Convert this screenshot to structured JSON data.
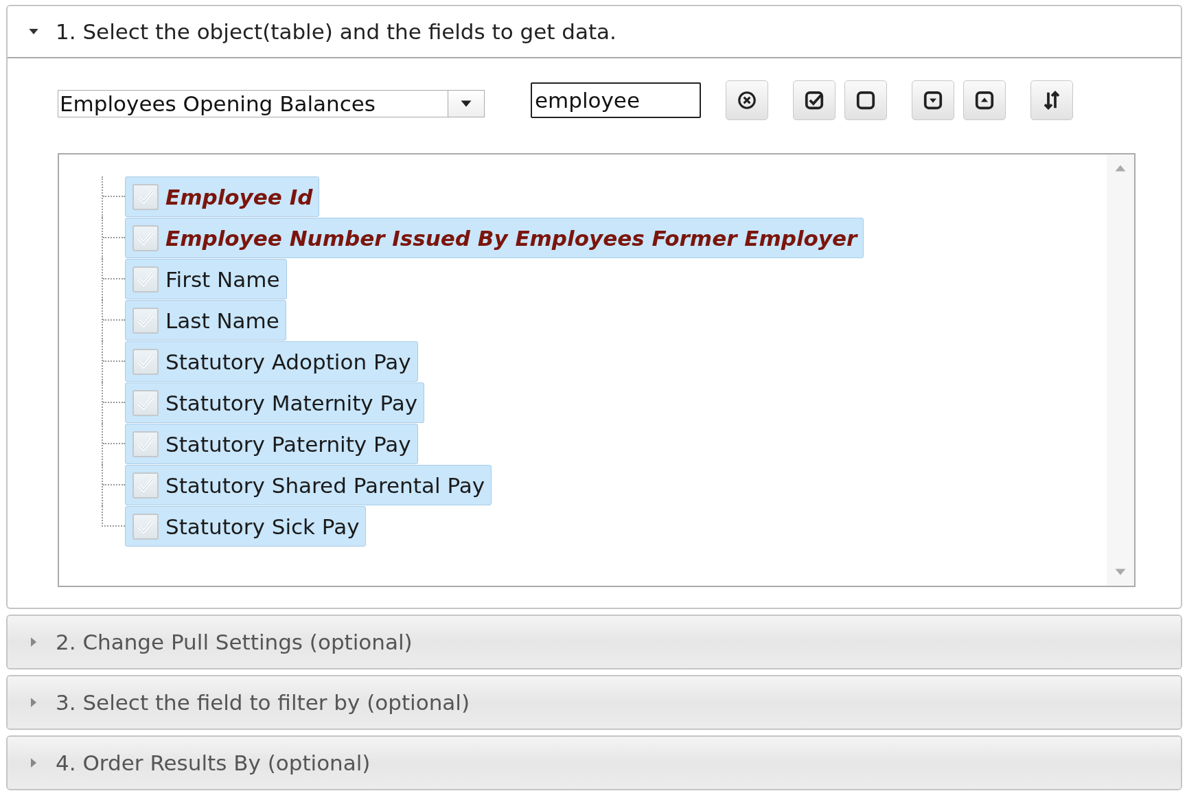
{
  "sections": [
    {
      "title": "1. Select the object(table) and the fields to get data.",
      "expanded": true
    },
    {
      "title": "2. Change Pull Settings (optional)",
      "expanded": false
    },
    {
      "title": "3. Select the field to filter by (optional)",
      "expanded": false
    },
    {
      "title": "4. Order Results By (optional)",
      "expanded": false
    }
  ],
  "object_select": {
    "value": "Employees Opening Balances"
  },
  "search": {
    "value": "employee"
  },
  "fields": [
    {
      "label": "Employee Id",
      "checked": true,
      "highlighted": true
    },
    {
      "label": "Employee Number Issued By Employees Former Employer",
      "checked": true,
      "highlighted": true
    },
    {
      "label": "First Name",
      "checked": true,
      "highlighted": false
    },
    {
      "label": "Last Name",
      "checked": true,
      "highlighted": false
    },
    {
      "label": "Statutory Adoption Pay",
      "checked": true,
      "highlighted": false
    },
    {
      "label": "Statutory Maternity Pay",
      "checked": true,
      "highlighted": false
    },
    {
      "label": "Statutory Paternity Pay",
      "checked": true,
      "highlighted": false
    },
    {
      "label": "Statutory Shared Parental Pay",
      "checked": true,
      "highlighted": false
    },
    {
      "label": "Statutory Sick Pay",
      "checked": true,
      "highlighted": false
    }
  ]
}
